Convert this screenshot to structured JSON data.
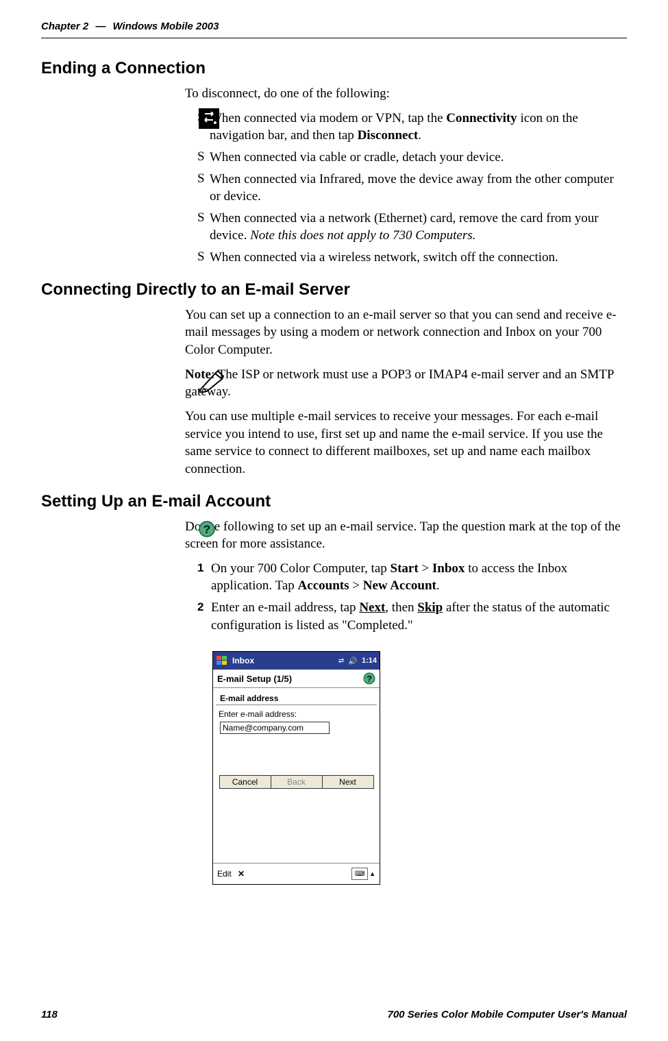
{
  "header": {
    "chapter": "Chapter 2",
    "dash": "—",
    "title": "Windows Mobile 2003"
  },
  "sections": {
    "ending": {
      "heading": "Ending a Connection",
      "intro": "To disconnect, do one of the following:",
      "b1_a": "When connected via modem or VPN, tap the ",
      "b1_b": "Connectivity",
      "b1_c": " icon on the navigation bar, and then tap ",
      "b1_d": "Disconnect",
      "b1_e": ".",
      "b2": "When connected via cable or cradle, detach your device.",
      "b3": "When connected via Infrared, move the device away from the other computer or device.",
      "b4_a": "When connected via a network (Ethernet) card, remove the card from your device. ",
      "b4_b": "Note this does not apply to 730 Computers.",
      "b5": "When connected via a wireless network, switch off the connection."
    },
    "connecting": {
      "heading": "Connecting Directly to an E-mail Server",
      "p1": "You can set up a connection to an e-mail server so that you can send and receive e-mail messages by using a modem or network connection and Inbox on your 700 Color Computer.",
      "note_a": "Note",
      "note_b": ": The ISP or network must use a POP3 or IMAP4 e-mail server and an SMTP gateway.",
      "p2": "You can use multiple e-mail services to receive your messages. For each e-mail service you intend to use, first set up and name the e-mail service. If you use the same service to connect to different mailboxes, set up and name each mailbox connection."
    },
    "setting": {
      "heading": "Setting Up an E-mail Account",
      "p1": "Do the following to set up an e-mail service. Tap the question mark at the top of the screen for more assistance.",
      "s1_a": "On your 700 Color Computer, tap ",
      "s1_b": "Start",
      "s1_c": " > ",
      "s1_d": "Inbox",
      "s1_e": " to access the Inbox application. Tap ",
      "s1_f": "Accounts",
      "s1_g": " > ",
      "s1_h": "New Account",
      "s1_i": ".",
      "s2_a": "Enter an e-mail address, tap ",
      "s2_b": "Next",
      "s2_c": ", then ",
      "s2_d": "Skip",
      "s2_e": " after the status of the automatic configuration is listed as \"Completed.\""
    }
  },
  "screenshot": {
    "app_title": "Inbox",
    "time": "1:14",
    "step": "E-mail Setup (1/5)",
    "section_label": "E-mail address",
    "field_label": "Enter e-mail address:",
    "input_value": "Name@company.com",
    "btn_cancel": "Cancel",
    "btn_back": "Back",
    "btn_next": "Next",
    "bottom_edit": "Edit"
  },
  "footer": {
    "page": "118",
    "manual": "700 Series Color Mobile Computer User's Manual"
  }
}
